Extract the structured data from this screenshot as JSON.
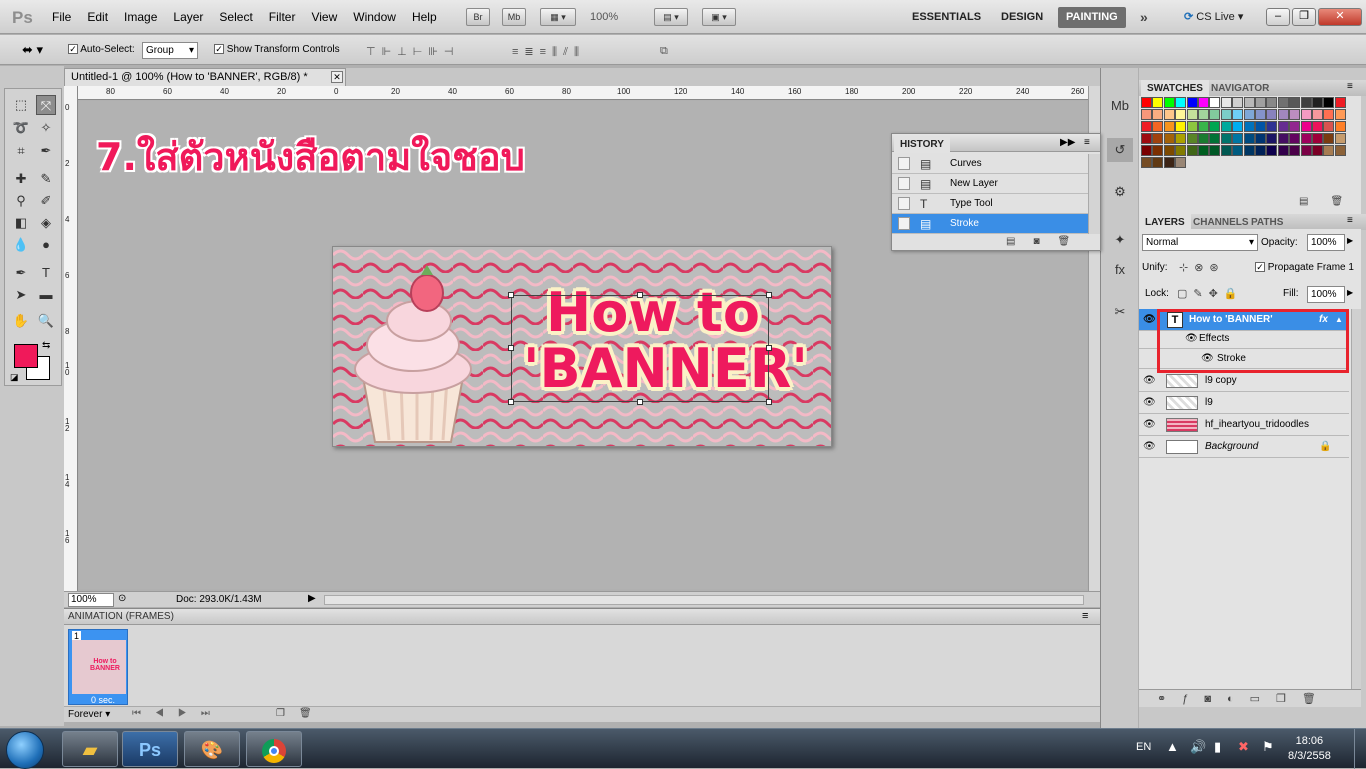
{
  "menubar": {
    "logo": "Ps",
    "menus": [
      "File",
      "Edit",
      "Image",
      "Layer",
      "Select",
      "Filter",
      "View",
      "Window",
      "Help"
    ],
    "bridge_btn": "Br",
    "minibridge_btn": "Mb",
    "zoom": "100%",
    "workspaces": {
      "essentials": "ESSENTIALS",
      "design": "DESIGN",
      "painting": "PAINTING"
    },
    "cs_live": "CS Live"
  },
  "options": {
    "auto_select_label": "Auto-Select:",
    "auto_select_value": "Group",
    "transform_label": "Show Transform Controls"
  },
  "document": {
    "tab_title": "Untitled-1 @ 100% (How to  'BANNER', RGB/8) *",
    "caption": "7.ใส่ตัวหนังสือตามใจชอบ",
    "banner_line1": "How to",
    "banner_line2": "'BANNER'",
    "zoom_field": "100%",
    "doc_info": "Doc: 293.0K/1.43M",
    "ruler_h": [
      "80",
      "60",
      "40",
      "20",
      "0",
      "20",
      "40",
      "60",
      "80",
      "100",
      "120",
      "140",
      "160",
      "180",
      "200",
      "220",
      "240",
      "260"
    ],
    "ruler_v": [
      "0",
      "2",
      "4",
      "6",
      "8",
      "1 0",
      "1 2",
      "1 4",
      "1 6"
    ]
  },
  "history": {
    "title": "HISTORY",
    "items": [
      {
        "label": "Curves",
        "icon": "doc-icon"
      },
      {
        "label": "New Layer",
        "icon": "doc-icon"
      },
      {
        "label": "Type Tool",
        "icon": "type-icon"
      },
      {
        "label": "Stroke",
        "icon": "doc-icon"
      }
    ]
  },
  "animation": {
    "title": "ANIMATION (FRAMES)",
    "frame_num": "1",
    "frame_time": "0 sec.",
    "thumb_text": "How to BANNER",
    "loop": "Forever"
  },
  "panels": {
    "swatches_tab": "SWATCHES",
    "navigator_tab": "NAVIGATOR",
    "layers_tab": "LAYERS",
    "channels_tab": "CHANNELS",
    "paths_tab": "PATHS"
  },
  "layers": {
    "blend_mode": "Normal",
    "opacity_label": "Opacity:",
    "opacity": "100%",
    "unify_label": "Unify:",
    "propagate_label": "Propagate Frame 1",
    "lock_label": "Lock:",
    "fill_label": "Fill:",
    "fill": "100%",
    "items": [
      {
        "name": "How to  'BANNER'",
        "type": "text",
        "selected": true
      },
      {
        "name": "Effects",
        "type": "effects"
      },
      {
        "name": "Stroke",
        "type": "effect"
      },
      {
        "name": "l9 copy",
        "type": "pixel"
      },
      {
        "name": "l9",
        "type": "pixel"
      },
      {
        "name": "hf_iheartyou_tridoodles",
        "type": "pixel"
      },
      {
        "name": "Background",
        "type": "background"
      }
    ]
  },
  "taskbar": {
    "lang": "EN",
    "time": "18:06",
    "date": "8/3/2558",
    "ps_label": "Ps"
  },
  "colors": {
    "foreground": "#f0195a",
    "background": "#ffffff",
    "accent_selection": "#3a8ee6",
    "annotation_red": "#e8232d"
  },
  "swatch_colors": [
    "#ff0000",
    "#ffff00",
    "#00ff00",
    "#00ffff",
    "#0000ff",
    "#ff00ff",
    "#ffffff",
    "#e8e8e8",
    "#d0d0d0",
    "#b8b8b8",
    "#a0a0a0",
    "#888888",
    "#707070",
    "#585858",
    "#404040",
    "#202020",
    "#000000",
    "#ee1c24",
    "#f7977a",
    "#f9ad81",
    "#fdc68a",
    "#fff79a",
    "#c4df9b",
    "#a2d39c",
    "#82ca9d",
    "#7bcdc8",
    "#6ecff6",
    "#7ea7d8",
    "#8493ca",
    "#8882be",
    "#a187be",
    "#bc8dbf",
    "#f49ac2",
    "#f6989d",
    "#ff6f51",
    "#ff9a56",
    "#ed1c24",
    "#f26522",
    "#f7941d",
    "#fff200",
    "#8dc63f",
    "#39b54a",
    "#00a651",
    "#00a99d",
    "#00aeef",
    "#0072bc",
    "#0054a6",
    "#2e3192",
    "#662d91",
    "#92278f",
    "#ec008c",
    "#ed145b",
    "#d9534f",
    "#ff7f27",
    "#9e0b0f",
    "#a0410d",
    "#a36209",
    "#aba000",
    "#598527",
    "#1a7b30",
    "#007236",
    "#00746b",
    "#0076a3",
    "#004b80",
    "#003471",
    "#1b1464",
    "#440e62",
    "#630460",
    "#9e005d",
    "#9e0039",
    "#7a3b10",
    "#c69c6d",
    "#790000",
    "#7b2e00",
    "#7d4900",
    "#827b00",
    "#406618",
    "#005e20",
    "#005826",
    "#005952",
    "#005b7f",
    "#003663",
    "#002157",
    "#0d004c",
    "#32004b",
    "#4b0049",
    "#7b0046",
    "#7a0026",
    "#a67c52",
    "#8c6239",
    "#754c24",
    "#603913",
    "#3c2415",
    "#998675"
  ]
}
